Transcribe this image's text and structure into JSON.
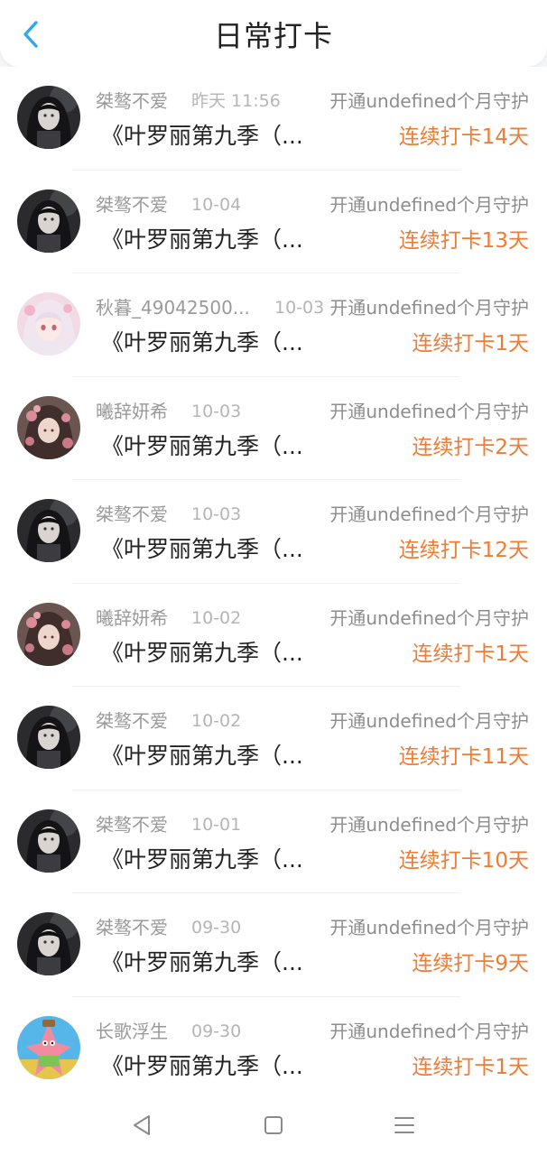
{
  "header": {
    "title": "日常打卡"
  },
  "colors": {
    "accent": "#2fa8f0",
    "streak": "#f07b34"
  },
  "records": [
    {
      "name": "桀骜不爱",
      "time": "昨天 11:56",
      "guard": "开通undefined个月守护",
      "book": "《叶罗丽第九季（...",
      "streak": "连续打卡14天",
      "avatar": "dark-portrait"
    },
    {
      "name": "桀骜不爱",
      "time": "10-04",
      "guard": "开通undefined个月守护",
      "book": "《叶罗丽第九季（...",
      "streak": "连续打卡13天",
      "avatar": "dark-portrait"
    },
    {
      "name": "秋暮_49042500...",
      "time": "10-03",
      "guard": "开通undefined个月守护",
      "book": "《叶罗丽第九季（...",
      "streak": "连续打卡1天",
      "avatar": "pink-anime-girl"
    },
    {
      "name": "曦辞妍希",
      "time": "10-03",
      "guard": "开通undefined个月守护",
      "book": "《叶罗丽第九季（...",
      "streak": "连续打卡2天",
      "avatar": "floral-girl"
    },
    {
      "name": "桀骜不爱",
      "time": "10-03",
      "guard": "开通undefined个月守护",
      "book": "《叶罗丽第九季（...",
      "streak": "连续打卡12天",
      "avatar": "dark-portrait"
    },
    {
      "name": "曦辞妍希",
      "time": "10-02",
      "guard": "开通undefined个月守护",
      "book": "《叶罗丽第九季（...",
      "streak": "连续打卡1天",
      "avatar": "floral-girl"
    },
    {
      "name": "桀骜不爱",
      "time": "10-02",
      "guard": "开通undefined个月守护",
      "book": "《叶罗丽第九季（...",
      "streak": "连续打卡11天",
      "avatar": "dark-portrait"
    },
    {
      "name": "桀骜不爱",
      "time": "10-01",
      "guard": "开通undefined个月守护",
      "book": "《叶罗丽第九季（...",
      "streak": "连续打卡10天",
      "avatar": "dark-portrait"
    },
    {
      "name": "桀骜不爱",
      "time": "09-30",
      "guard": "开通undefined个月守护",
      "book": "《叶罗丽第九季（...",
      "streak": "连续打卡9天",
      "avatar": "dark-portrait"
    },
    {
      "name": "长歌浮生",
      "time": "09-30",
      "guard": "开通undefined个月守护",
      "book": "《叶罗丽第九季（...",
      "streak": "连续打卡1天",
      "avatar": "cartoon-starfish"
    }
  ]
}
